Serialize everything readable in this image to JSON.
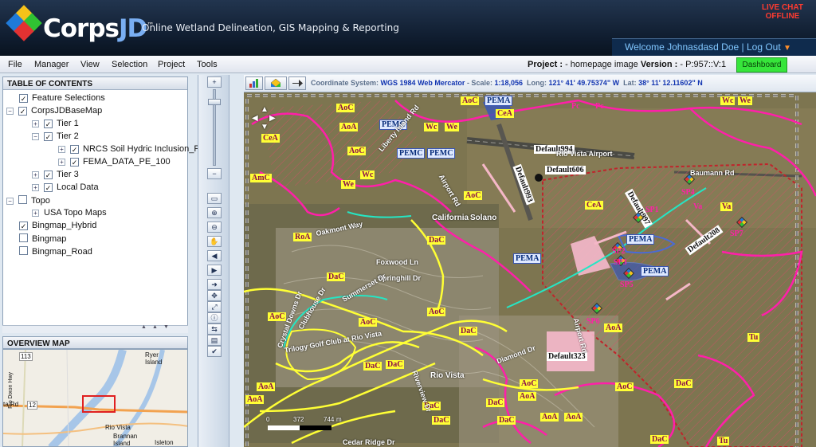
{
  "header": {
    "brand_a": "Corps",
    "brand_b": "JD",
    "tm": "™",
    "tagline": "Online Wetland Delineation, GIS Mapping & Reporting",
    "live_chat_line1": "LIVE CHAT",
    "live_chat_line2": "OFFLINE",
    "welcome": "Welcome  Johnasdasd Doe | Log Out"
  },
  "menu": [
    "File",
    "Manager",
    "View",
    "Selection",
    "Project",
    "Tools"
  ],
  "project": {
    "label": "Project :",
    "value": " - homepage image ",
    "version_label": "Version :",
    "version_value": " - P:957::V:1"
  },
  "dashboard_label": "Dashboard",
  "toc": {
    "title": "TABLE OF CONTENTS",
    "items": [
      {
        "label": "Feature Selections",
        "checked": true
      },
      {
        "label": "CorpsJDBaseMap",
        "checked": true
      },
      {
        "label": "Tier 1",
        "checked": true
      },
      {
        "label": "Tier 2",
        "checked": true
      },
      {
        "label": "NRCS Soil Hydric Inclusion_P",
        "checked": true
      },
      {
        "label": "FEMA_DATA_PE_100",
        "checked": true
      },
      {
        "label": "Tier 3",
        "checked": true
      },
      {
        "label": "Local Data",
        "checked": true
      },
      {
        "label": "Topo",
        "checked": false
      },
      {
        "label": "USA Topo Maps",
        "checked": false
      },
      {
        "label": "Bingmap_Hybrid",
        "checked": true
      },
      {
        "label": "Bingmap",
        "checked": false
      },
      {
        "label": "Bingmap_Road",
        "checked": false
      }
    ]
  },
  "overview": {
    "title": "OVERVIEW MAP",
    "labels": [
      "113",
      "Ryer Island",
      "Rio Dixon Hwy",
      "12",
      "Rio Vista",
      "Brannan Island",
      "Isleton",
      "ta Rd"
    ]
  },
  "coord_bar": {
    "cs_label": "Coordinate System:",
    "cs_value": "WGS 1984 Web Mercator",
    "scale_label": "- Scale:",
    "scale_value": "1:18,056",
    "long_label": "Long:",
    "long_value": "121° 41' 49.75374\" W",
    "lat_label": "Lat:",
    "lat_value": "38° 11' 12.11602\" N"
  },
  "map": {
    "scale_bar": [
      "0",
      "372",
      "744",
      "m"
    ],
    "soil_labels": [
      "AoC",
      "CeA",
      "AoA",
      "AoC",
      "Wc",
      "We",
      "Pc",
      "Pc",
      "Wc",
      "We",
      "AmC",
      "We",
      "Wc",
      "AoC",
      "AoC",
      "RoA",
      "DaC",
      "AoC",
      "DaC",
      "AoC",
      "AoC",
      "DaC",
      "DaC",
      "DaC",
      "AoC",
      "AoA",
      "AoA",
      "AoA",
      "DaC",
      "DaC",
      "AoC",
      "DaC",
      "DaC",
      "AoA",
      "AoA",
      "AoA",
      "DaC",
      "DaC",
      "Tu",
      "Tu",
      "CeA",
      "Va",
      "Va",
      "CeA"
    ],
    "pema_labels": [
      "PEMA",
      "PEMC",
      "PEMC",
      "PEMC",
      "PEMA",
      "PEMA",
      "PEMA"
    ],
    "default_labels": [
      "Default994",
      "Default606",
      "Default993",
      "Default997",
      "Default208",
      "Default323"
    ],
    "sp_labels": [
      "SP4",
      "SP1",
      "SP7",
      "SP2",
      "SP3",
      "SP5",
      "SP6"
    ],
    "street_labels": [
      "California",
      "Solano",
      "Airport Rd",
      "Foxwood Ln",
      "Springhill Dr",
      "Trilogy Golf Club at Rio Vista",
      "Rio Vista",
      "Baumann Rd",
      "Rio Vista Airport",
      "Airport Rd",
      "Cedar Ridge Dr",
      "Crystal Downs Dr",
      "Oakmont Way",
      "Diamond Dr",
      "Liberty Island Rd",
      "Summerset Dr",
      "Clubhouse Dr",
      "Riverview Dr"
    ]
  },
  "colors": {
    "header_bg": "#0f1c2e",
    "welcome_bg": "#0f2b4d",
    "welcome_text": "#81c7ff",
    "live_chat": "#ff3b30",
    "dashboard": "#37e53b",
    "soil_line": "#ff1fa9",
    "fema_line": "#ffff35",
    "wetland_fill": "#3a57b5"
  },
  "icons": [
    "logo-diamond-icon",
    "dropdown-caret-icon",
    "zoom-in-icon",
    "zoom-out-icon",
    "pan-icon",
    "identify-icon",
    "measure-icon",
    "refresh-icon",
    "layers-icon",
    "full-extent-icon",
    "checkmark-icon",
    "pan-arrows-icon",
    "chart-icon",
    "map-export-icon",
    "arrow-icon"
  ]
}
